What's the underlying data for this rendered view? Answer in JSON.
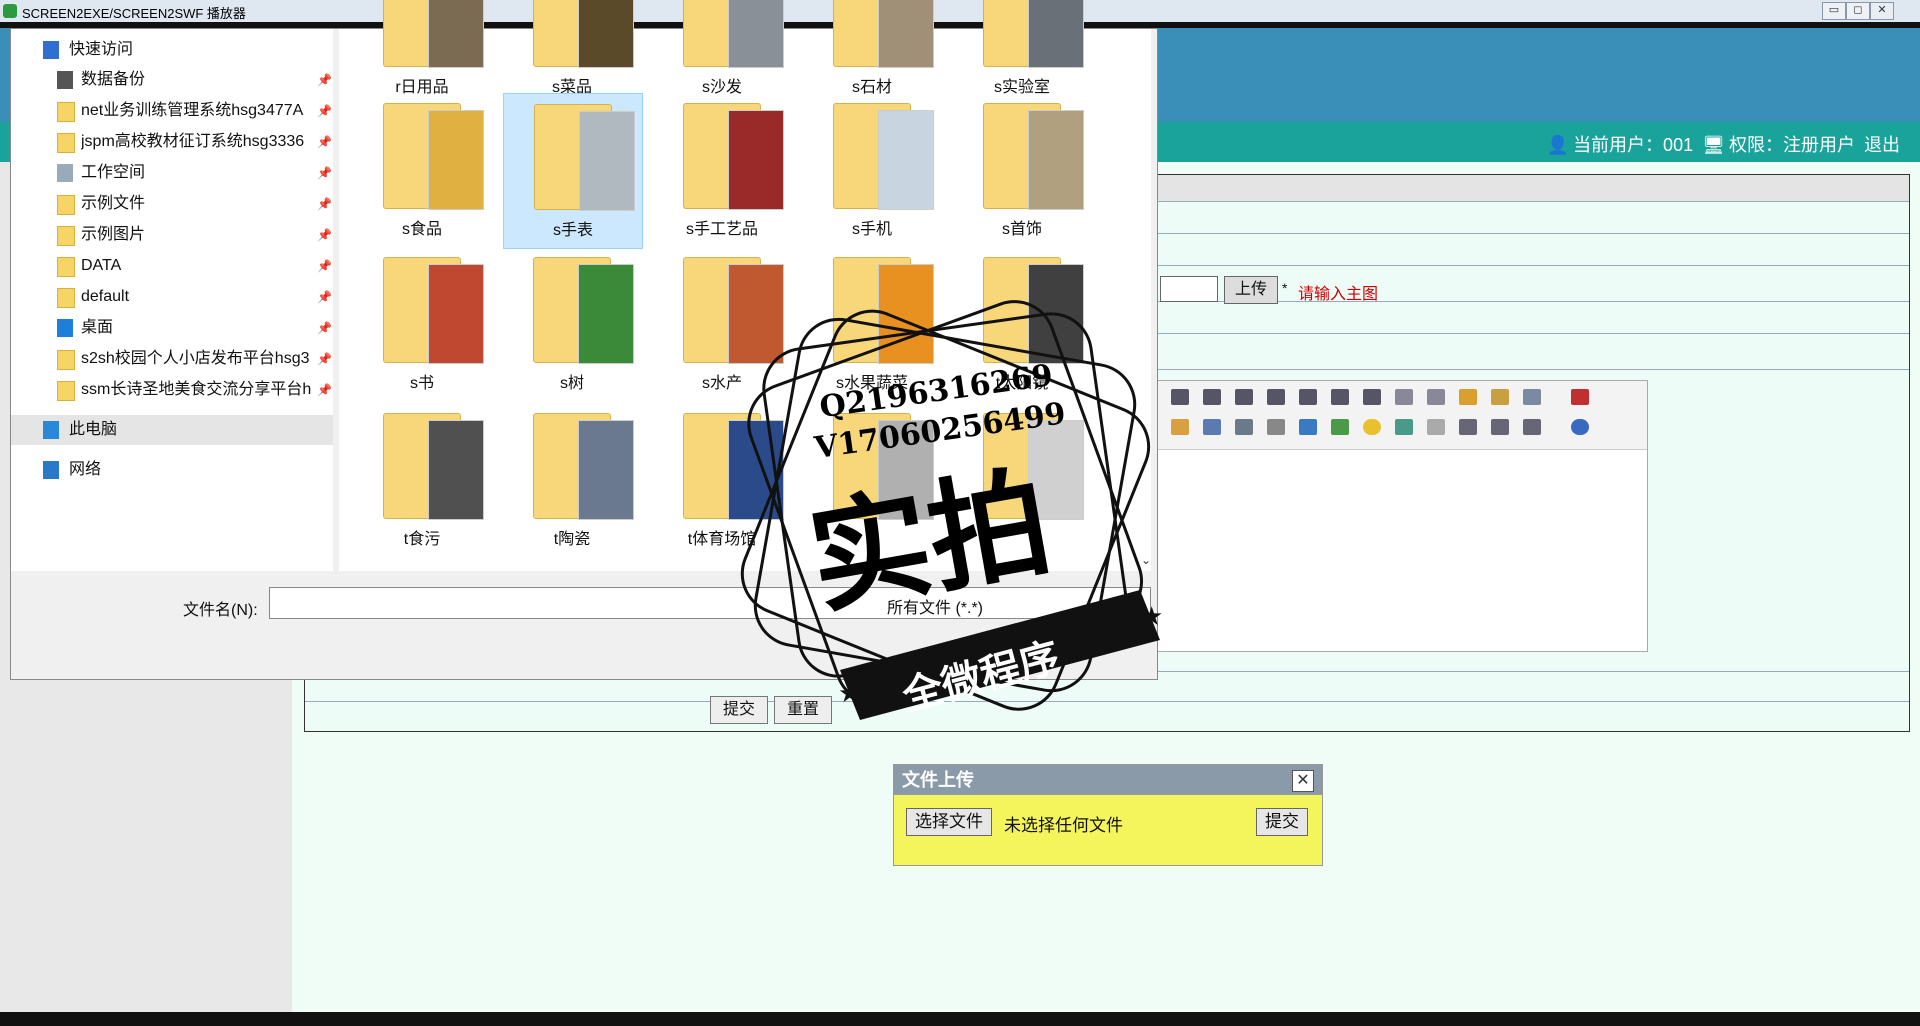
{
  "window": {
    "title": "SCREEN2EXE/SCREEN2SWF 播放器",
    "btn_min": "▭",
    "btn_max": "◻",
    "btn_close": "✕"
  },
  "app": {
    "user_label": "当前用户：001",
    "perm_label": "权限：注册用户",
    "logout": "退出",
    "upload_btn": "上传",
    "required_star": "*",
    "required_hint": "请输入主图",
    "submit_btn": "提交",
    "reset_btn": "重置"
  },
  "upload_popup": {
    "title": "文件上传",
    "close": "✕",
    "choose_file": "选择文件",
    "no_file": "未选择任何文件",
    "submit": "提交"
  },
  "file_dialog": {
    "nav": [
      {
        "label": "快速访问",
        "icon": "star-icon",
        "pinned": false
      },
      {
        "label": "数据备份",
        "icon": "drive-icon",
        "pinned": true
      },
      {
        "label": "net业务训练管理系统hsg3477A",
        "icon": "folder-icon",
        "pinned": true
      },
      {
        "label": "jspm高校教材征订系统hsg3336",
        "icon": "folder-icon",
        "pinned": true
      },
      {
        "label": "工作空间",
        "icon": "document-icon",
        "pinned": true
      },
      {
        "label": "示例文件",
        "icon": "folder-icon",
        "pinned": true
      },
      {
        "label": "示例图片",
        "icon": "folder-icon",
        "pinned": true
      },
      {
        "label": "DATA",
        "icon": "folder-icon",
        "pinned": true
      },
      {
        "label": "default",
        "icon": "folder-icon",
        "pinned": true
      },
      {
        "label": "桌面",
        "icon": "desktop-icon",
        "pinned": true
      },
      {
        "label": "s2sh校园个人小店发布平台hsg3",
        "icon": "folder-icon",
        "pinned": true
      },
      {
        "label": "ssm长诗圣地美食交流分享平台h",
        "icon": "folder-icon",
        "pinned": true
      },
      {
        "label": "此电脑",
        "icon": "computer-icon",
        "pinned": false
      },
      {
        "label": "网络",
        "icon": "network-icon",
        "pinned": false
      }
    ],
    "pin_glyph": "📌",
    "folders": [
      {
        "name": "r日用品",
        "color": "#7a6b52"
      },
      {
        "name": "s菜品",
        "color": "#5a4a2a"
      },
      {
        "name": "s沙发",
        "color": "#8a9098"
      },
      {
        "name": "s石材",
        "color": "#a09078"
      },
      {
        "name": "s实验室",
        "color": "#6a7078"
      },
      {
        "name": "s食品",
        "color": "#e0b040"
      },
      {
        "name": "s手表",
        "color": "#b0b8c0"
      },
      {
        "name": "s手工艺品",
        "color": "#9a2a2a"
      },
      {
        "name": "s手机",
        "color": "#c8d4e0"
      },
      {
        "name": "s首饰",
        "color": "#b0a080"
      },
      {
        "name": "s书",
        "color": "#c04830"
      },
      {
        "name": "s树",
        "color": "#3a8a3a"
      },
      {
        "name": "s水产",
        "color": "#c05830"
      },
      {
        "name": "s水果蔬菜",
        "color": "#e89020"
      },
      {
        "name": "t太阳镜",
        "color": "#404040"
      },
      {
        "name": "t食污",
        "color": "#505050"
      },
      {
        "name": "t陶瓷",
        "color": "#6a7890"
      },
      {
        "name": "t体育场馆",
        "color": "#2a4a8a"
      },
      {
        "name": "t",
        "color": "#b0b0b0"
      },
      {
        "name": "",
        "color": "#d0d0d0"
      }
    ],
    "filename_label": "文件名(N):",
    "filter_text": "所有文件 (*.*)",
    "scroll_arrow": "⌄"
  },
  "stamp": {
    "line1": "Q2196316269",
    "line2": "V17060256499",
    "main": "实拍",
    "banner": "全微程序"
  }
}
